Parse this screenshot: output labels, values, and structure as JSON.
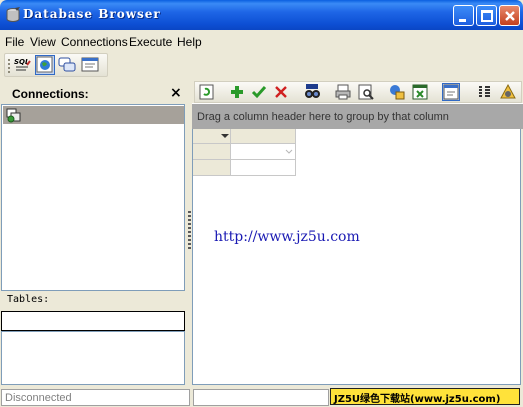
{
  "window": {
    "title": "Database Browser"
  },
  "menu": [
    "File",
    "View",
    "Connections",
    "Execute",
    "Help"
  ],
  "connections_panel": {
    "title": "Connections:",
    "close": "×"
  },
  "tables_panel": {
    "label": "Tables:"
  },
  "grid": {
    "group_hint": "Drag a column header here to group by that column"
  },
  "content": {
    "url": "http://www.jz5u.com"
  },
  "status": {
    "left": "Disconnected"
  },
  "watermark": "JZ5U绿色下载站(www.jz5u.com)",
  "toolbar_main": [
    "sql-icon",
    "globe-icon",
    "chat-icon",
    "form-icon"
  ],
  "toolbar_grid": [
    "refresh-icon",
    "add-icon",
    "check-icon",
    "delete-icon",
    "binoculars-icon",
    "print-icon",
    "preview-icon",
    "export-icon",
    "excel-icon",
    "panel-icon",
    "columns-icon",
    "settings-icon"
  ],
  "colors": {
    "titlebar": "#0A5FE0",
    "window_bg": "#ECE9D8",
    "group_area": "#A8A8A8",
    "selected_row": "#A6A19A",
    "watermark_bg": "#FFE23A"
  }
}
